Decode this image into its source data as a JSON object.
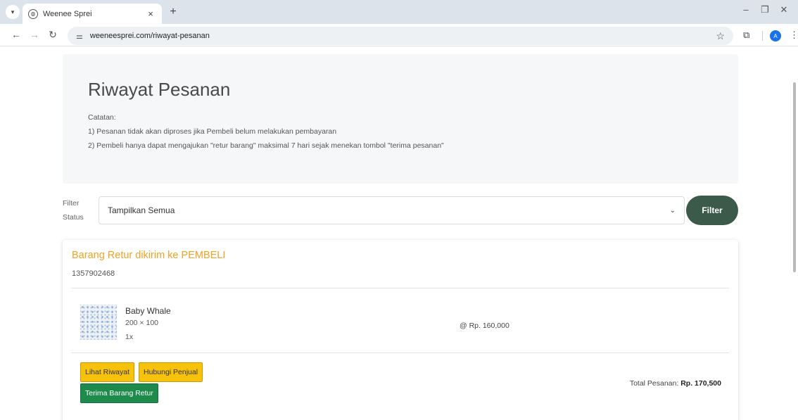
{
  "browser": {
    "tab_title": "Weenee Sprei",
    "url": "weeneesprei.com/riwayat-pesanan",
    "profile_initial": "A"
  },
  "page": {
    "title": "Riwayat Pesanan",
    "notes": [
      "Catatan:",
      "1) Pesanan tidak akan diproses jika Pembeli belum melakukan pembayaran",
      "2) Pembeli hanya dapat mengajukan \"retur barang\" maksimal 7 hari sejak menekan tombol \"terima pesanan\""
    ]
  },
  "filter": {
    "label_line1": "Filter",
    "label_line2": "Status",
    "selected": "Tampilkan Semua",
    "button": "Filter"
  },
  "order": {
    "status": "Barang Retur dikirim ke PEMBELI",
    "order_id": "1357902468",
    "item": {
      "name": "Baby Whale",
      "size": "200 × 100",
      "qty": "1x",
      "price": "@ Rp. 160,000"
    },
    "buttons": {
      "history": "Lihat Riwayat",
      "contact": "Hubungi Penjual",
      "accept_return": "Terima Barang Retur"
    },
    "total_label": "Total Pesanan:",
    "total_value": "Rp. 170,500"
  },
  "colors": {
    "status_orange": "#f0a223",
    "filter_button": "#3b5a4a",
    "button_yellow": "#f7c20c",
    "button_green": "#1e8a4c"
  }
}
